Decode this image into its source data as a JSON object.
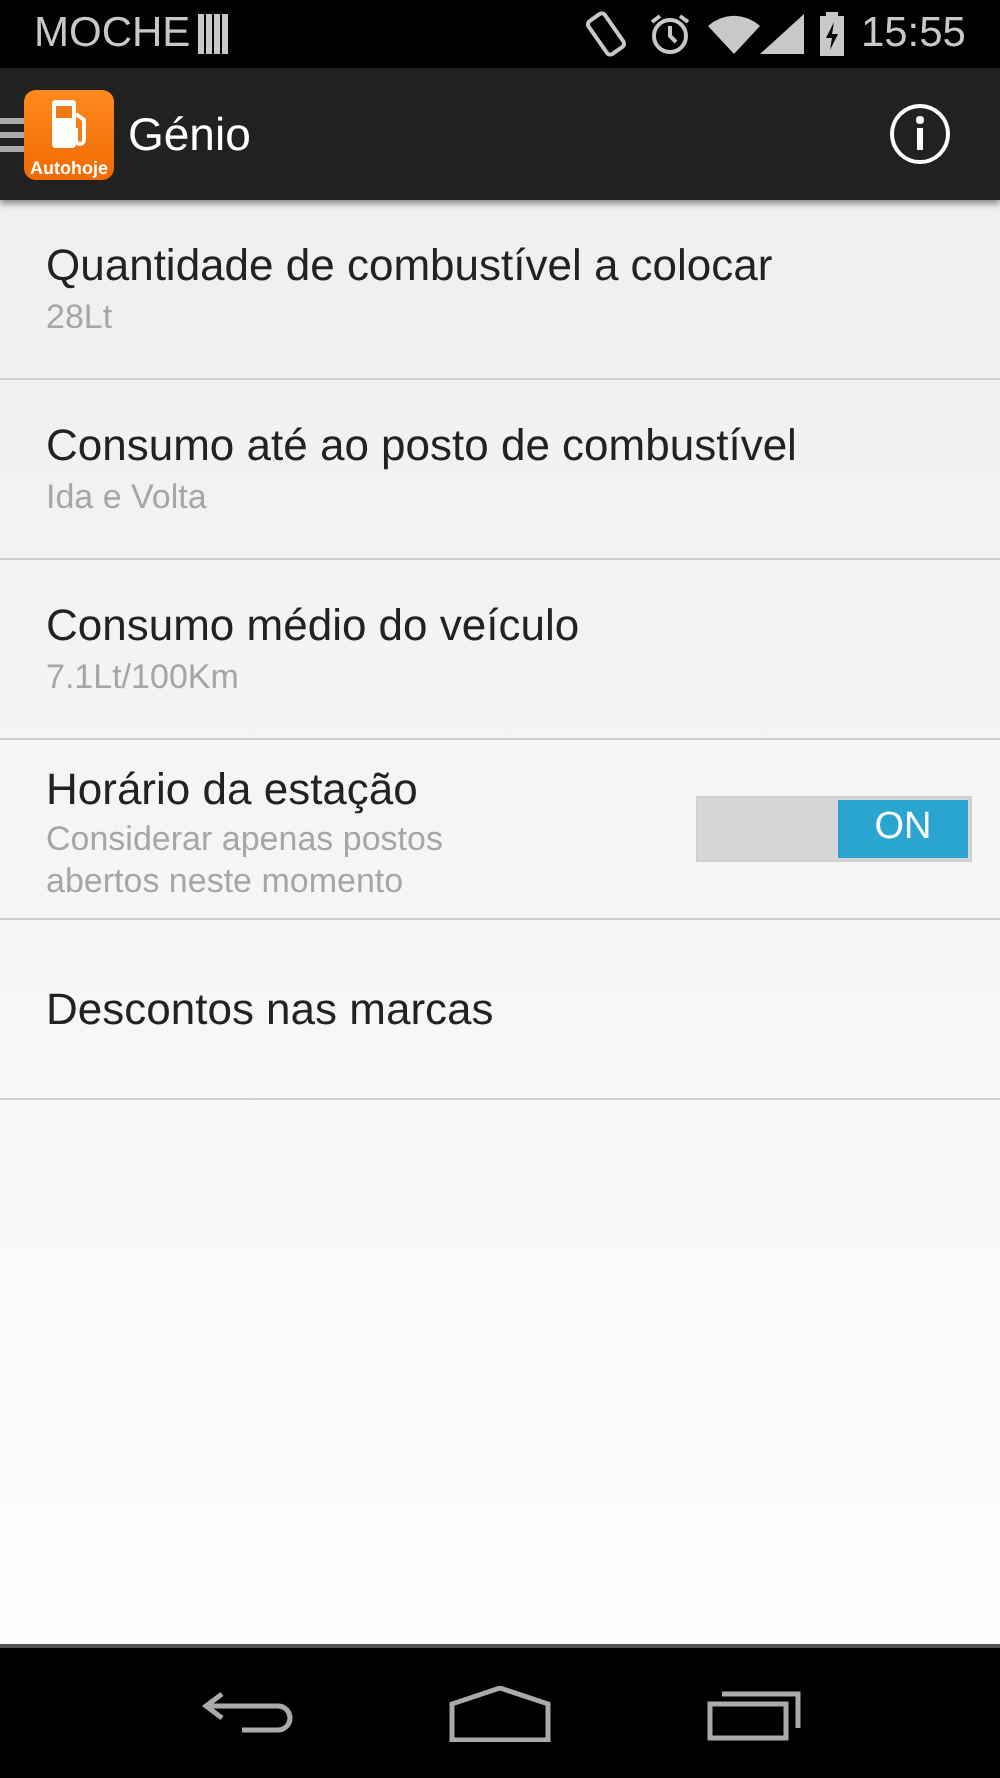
{
  "status_bar": {
    "carrier": "MOCHE",
    "time": "15:55"
  },
  "action_bar": {
    "logo_text": "Autohoje",
    "title": "Génio"
  },
  "settings": [
    {
      "kind": "text",
      "title": "Quantidade de combustível a colocar",
      "summary": "28Lt"
    },
    {
      "kind": "text",
      "title": "Consumo até ao posto de combustível",
      "summary": "Ida e Volta"
    },
    {
      "kind": "text",
      "title": "Consumo médio do veículo",
      "summary": "7.1Lt/100Km"
    },
    {
      "kind": "switch",
      "title": "Horário da estação",
      "summary": "Considerar apenas postos abertos neste momento",
      "on": true,
      "switch_label": "ON"
    },
    {
      "kind": "text",
      "title": "Descontos nas marcas"
    }
  ]
}
